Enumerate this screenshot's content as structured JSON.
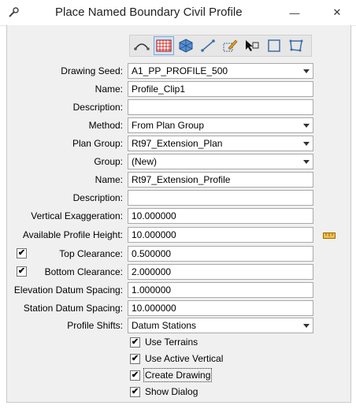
{
  "window": {
    "title": "Place Named Boundary Civil Profile",
    "minimize": "—",
    "close": "✕"
  },
  "toolbar": {
    "tools": [
      "profile-shape-icon",
      "grid-icon",
      "cube-icon",
      "line-icon",
      "edit-pencil-icon",
      "cursor-cube-icon",
      "square-icon",
      "polygon-icon"
    ],
    "active_index": 1
  },
  "form": {
    "drawing_seed": {
      "label": "Drawing Seed:",
      "value": "A1_PP_PROFILE_500"
    },
    "name1": {
      "label": "Name:",
      "value": "Profile_Clip1"
    },
    "description1": {
      "label": "Description:",
      "value": ""
    },
    "method": {
      "label": "Method:",
      "value": "From Plan Group"
    },
    "plan_group": {
      "label": "Plan Group:",
      "value": "Rt97_Extension_Plan"
    },
    "group": {
      "label": "Group:",
      "value": "(New)"
    },
    "name2": {
      "label": "Name:",
      "value": "Rt97_Extension_Profile"
    },
    "description2": {
      "label": "Description:",
      "value": ""
    },
    "vertical_exaggeration": {
      "label": "Vertical Exaggeration:",
      "value": "10.000000"
    },
    "available_profile_height": {
      "label": "Available Profile Height:",
      "value": "10.000000"
    },
    "top_clearance": {
      "label": "Top Clearance:",
      "value": "0.500000",
      "checked": true
    },
    "bottom_clearance": {
      "label": "Bottom Clearance:",
      "value": "2.000000",
      "checked": true
    },
    "elevation_datum_spacing": {
      "label": "Elevation Datum Spacing:",
      "value": "1.000000"
    },
    "station_datum_spacing": {
      "label": "Station Datum Spacing:",
      "value": "10.000000"
    },
    "profile_shifts": {
      "label": "Profile Shifts:",
      "value": "Datum Stations"
    }
  },
  "options": [
    {
      "label": "Use Terrains",
      "checked": true
    },
    {
      "label": "Use Active Vertical",
      "checked": true
    },
    {
      "label": "Create Drawing",
      "checked": true
    },
    {
      "label": "Show Dialog",
      "checked": true
    }
  ],
  "check_mark": "✔"
}
